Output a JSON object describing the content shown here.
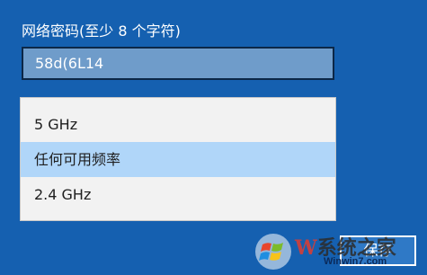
{
  "colors": {
    "background": "#1560b0",
    "input_background": "#6f9cca",
    "input_border": "#0c2747",
    "dropdown_background": "#f2f2f2",
    "selected_option": "#b0d6f9",
    "button_background": "#2f79c6"
  },
  "password": {
    "label": "网络密码(至少 8 个字符)",
    "value": "58d(6L14"
  },
  "frequency_options": [
    {
      "label": "5 GHz",
      "selected": false
    },
    {
      "label": "任何可用频率",
      "selected": true
    },
    {
      "label": "2.4 GHz",
      "selected": false
    }
  ],
  "save_button": {
    "label": "保存"
  },
  "watermark": {
    "brand_initial": "W",
    "brand_rest": "系统之家",
    "url": "Winwin7.com"
  }
}
